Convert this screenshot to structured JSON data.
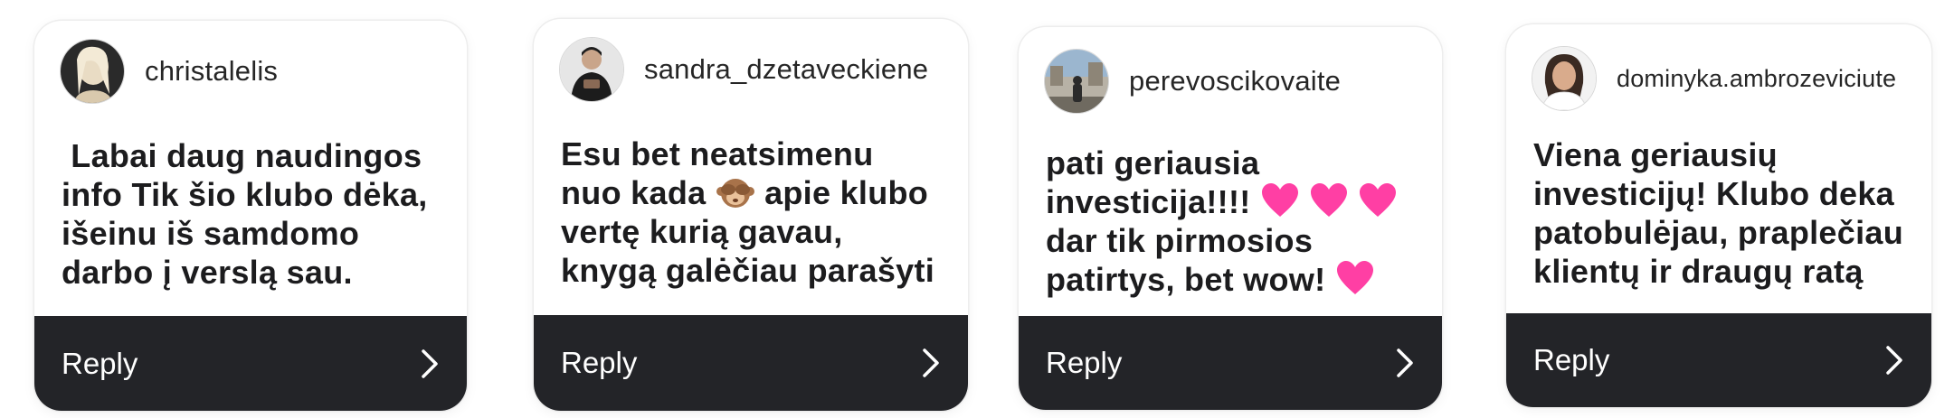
{
  "colors": {
    "reply_bar": "#232428",
    "reply_text": "#ffffff",
    "message_text": "#1c1c1e",
    "username_text": "#262626",
    "heart": "#ff3fa4"
  },
  "cards": [
    {
      "username": "christalelis",
      "avatar": "avatar-photo",
      "message_lines": [
        " Labai daug naudingos",
        "info Tik šio klubo dėka,",
        "išeinu iš samdomo",
        "darbo į verslą sau."
      ],
      "reply_label": "Reply",
      "chevron_icon": "chevron-right-icon"
    },
    {
      "username": "sandra_dzetaveckiene",
      "avatar": "avatar-photo",
      "message_lines": [
        "Esu bet neatsimenu",
        "nuo kada",
        "apie klubo",
        "vertę kurią gavau,",
        "knygą galėčiau parašyti"
      ],
      "inline_emoji": "see-no-evil-monkey-emoji",
      "reply_label": "Reply",
      "chevron_icon": "chevron-right-icon"
    },
    {
      "username": "perevoscikovaite",
      "avatar": "avatar-photo",
      "message_lines": [
        "pati geriausia",
        "investicija!!!!",
        "dar tik pirmosios",
        "patirtys, bet wow!"
      ],
      "inline_emoji": "pink-heart-emoji",
      "reply_label": "Reply",
      "chevron_icon": "chevron-right-icon"
    },
    {
      "username": "dominyka.ambrozeviciute",
      "avatar": "avatar-photo",
      "message_lines": [
        "Viena geriausių",
        "investicijų! Klubo deka",
        "patobulėjau, praplečiau",
        "klientų ir draugų ratą"
      ],
      "reply_label": "Reply",
      "chevron_icon": "chevron-right-icon"
    }
  ]
}
